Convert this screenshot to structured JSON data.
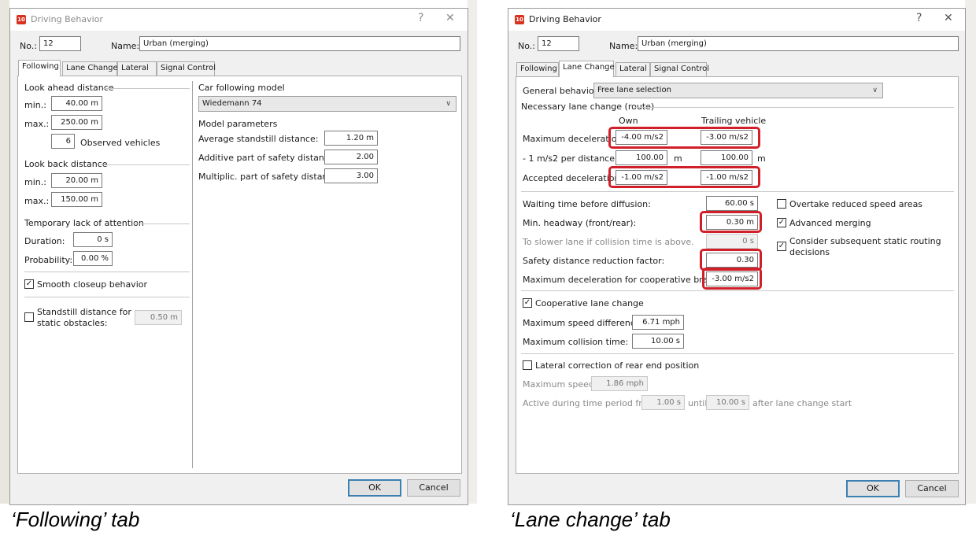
{
  "left": {
    "title": "Driving Behavior",
    "help": "?",
    "close": "✕",
    "no_label": "No.:",
    "no_value": "12",
    "name_label": "Name:",
    "name_value": "Urban (merging)",
    "tabs": [
      "Following",
      "Lane Change",
      "Lateral",
      "Signal Control"
    ],
    "look_ahead": {
      "header": "Look ahead distance",
      "min_label": "min.:",
      "min_value": "40.00 m",
      "max_label": "max.:",
      "max_value": "250.00 m",
      "obs_value": "6",
      "obs_label": "Observed vehicles"
    },
    "look_back": {
      "header": "Look back distance",
      "min_label": "min.:",
      "min_value": "20.00 m",
      "max_label": "max.:",
      "max_value": "150.00 m"
    },
    "attention": {
      "header": "Temporary lack of attention",
      "dur_label": "Duration:",
      "dur_value": "0 s",
      "prob_label": "Probability:",
      "prob_value": "0.00 %"
    },
    "smooth_label": "Smooth closeup behavior",
    "standstill_label1": "Standstill distance for",
    "standstill_label2": "static obstacles:",
    "standstill_value": "0.50 m",
    "model": {
      "header": "Car following model",
      "selected": "Wiedemann 74",
      "params_header": "Model parameters",
      "p1_label": "Average standstill distance:",
      "p1_value": "1.20 m",
      "p2_label": "Additive part of safety distance:",
      "p2_value": "2.00",
      "p3_label": "Multiplic. part of safety distance:",
      "p3_value": "3.00"
    },
    "ok": "OK",
    "cancel": "Cancel"
  },
  "right": {
    "title": "Driving Behavior",
    "help": "?",
    "close": "✕",
    "no_label": "No.:",
    "no_value": "12",
    "name_label": "Name:",
    "name_value": "Urban (merging)",
    "tabs": [
      "Following",
      "Lane Change",
      "Lateral",
      "Signal Control"
    ],
    "general_label": "General behavior:",
    "general_value": "Free lane selection",
    "necessary_header": "Necessary lane change (route)",
    "own": "Own",
    "trailing": "Trailing vehicle",
    "maxdec_label": "Maximum deceleration:",
    "maxdec_own": "-4.00 m/s2",
    "maxdec_trail": "-3.00 m/s2",
    "perdist_label": "- 1 m/s2 per distance:",
    "perdist_own": "100.00",
    "perdist_trail": "100.00",
    "unit_m": "m",
    "accdec_label": "Accepted deceleration:",
    "accdec_own": "-1.00 m/s2",
    "accdec_trail": "-1.00 m/s2",
    "wait_label": "Waiting time before diffusion:",
    "wait_value": "60.00 s",
    "headway_label": "Min. headway (front/rear):",
    "headway_value": "0.30 m",
    "slower_label": "To slower lane if collision time is above.",
    "slower_value": "0 s",
    "safety_label": "Safety distance reduction factor:",
    "safety_value": "0.30",
    "coopbrake_label": "Maximum deceleration for cooperative braking:",
    "coopbrake_value": "-3.00 m/s2",
    "overtake_label": "Overtake reduced speed areas",
    "advmerge_label": "Advanced merging",
    "consider_label1": "Consider subsequent static routing",
    "consider_label2": "decisions",
    "coop_label": "Cooperative lane change",
    "maxspeeddiff_label": "Maximum speed difference:",
    "maxspeeddiff_value": "6.71 mph",
    "maxcoll_label": "Maximum collision time:",
    "maxcoll_value": "10.00 s",
    "lateral_label": "Lateral correction of rear end position",
    "maxspeed_label": "Maximum speed:",
    "maxspeed_value": "1.86 mph",
    "active_label": "Active during time period from",
    "active_from": "1.00 s",
    "until": "until",
    "active_until": "10.00 s",
    "after": "after lane change start",
    "ok": "OK",
    "cancel": "Cancel"
  },
  "captions": {
    "left": "‘Following’ tab",
    "right": "‘Lane change’ tab"
  },
  "colors": {
    "highlight": "#d11f2a",
    "app_icon": "#d7321f",
    "default_button": "#3c7fb1"
  }
}
